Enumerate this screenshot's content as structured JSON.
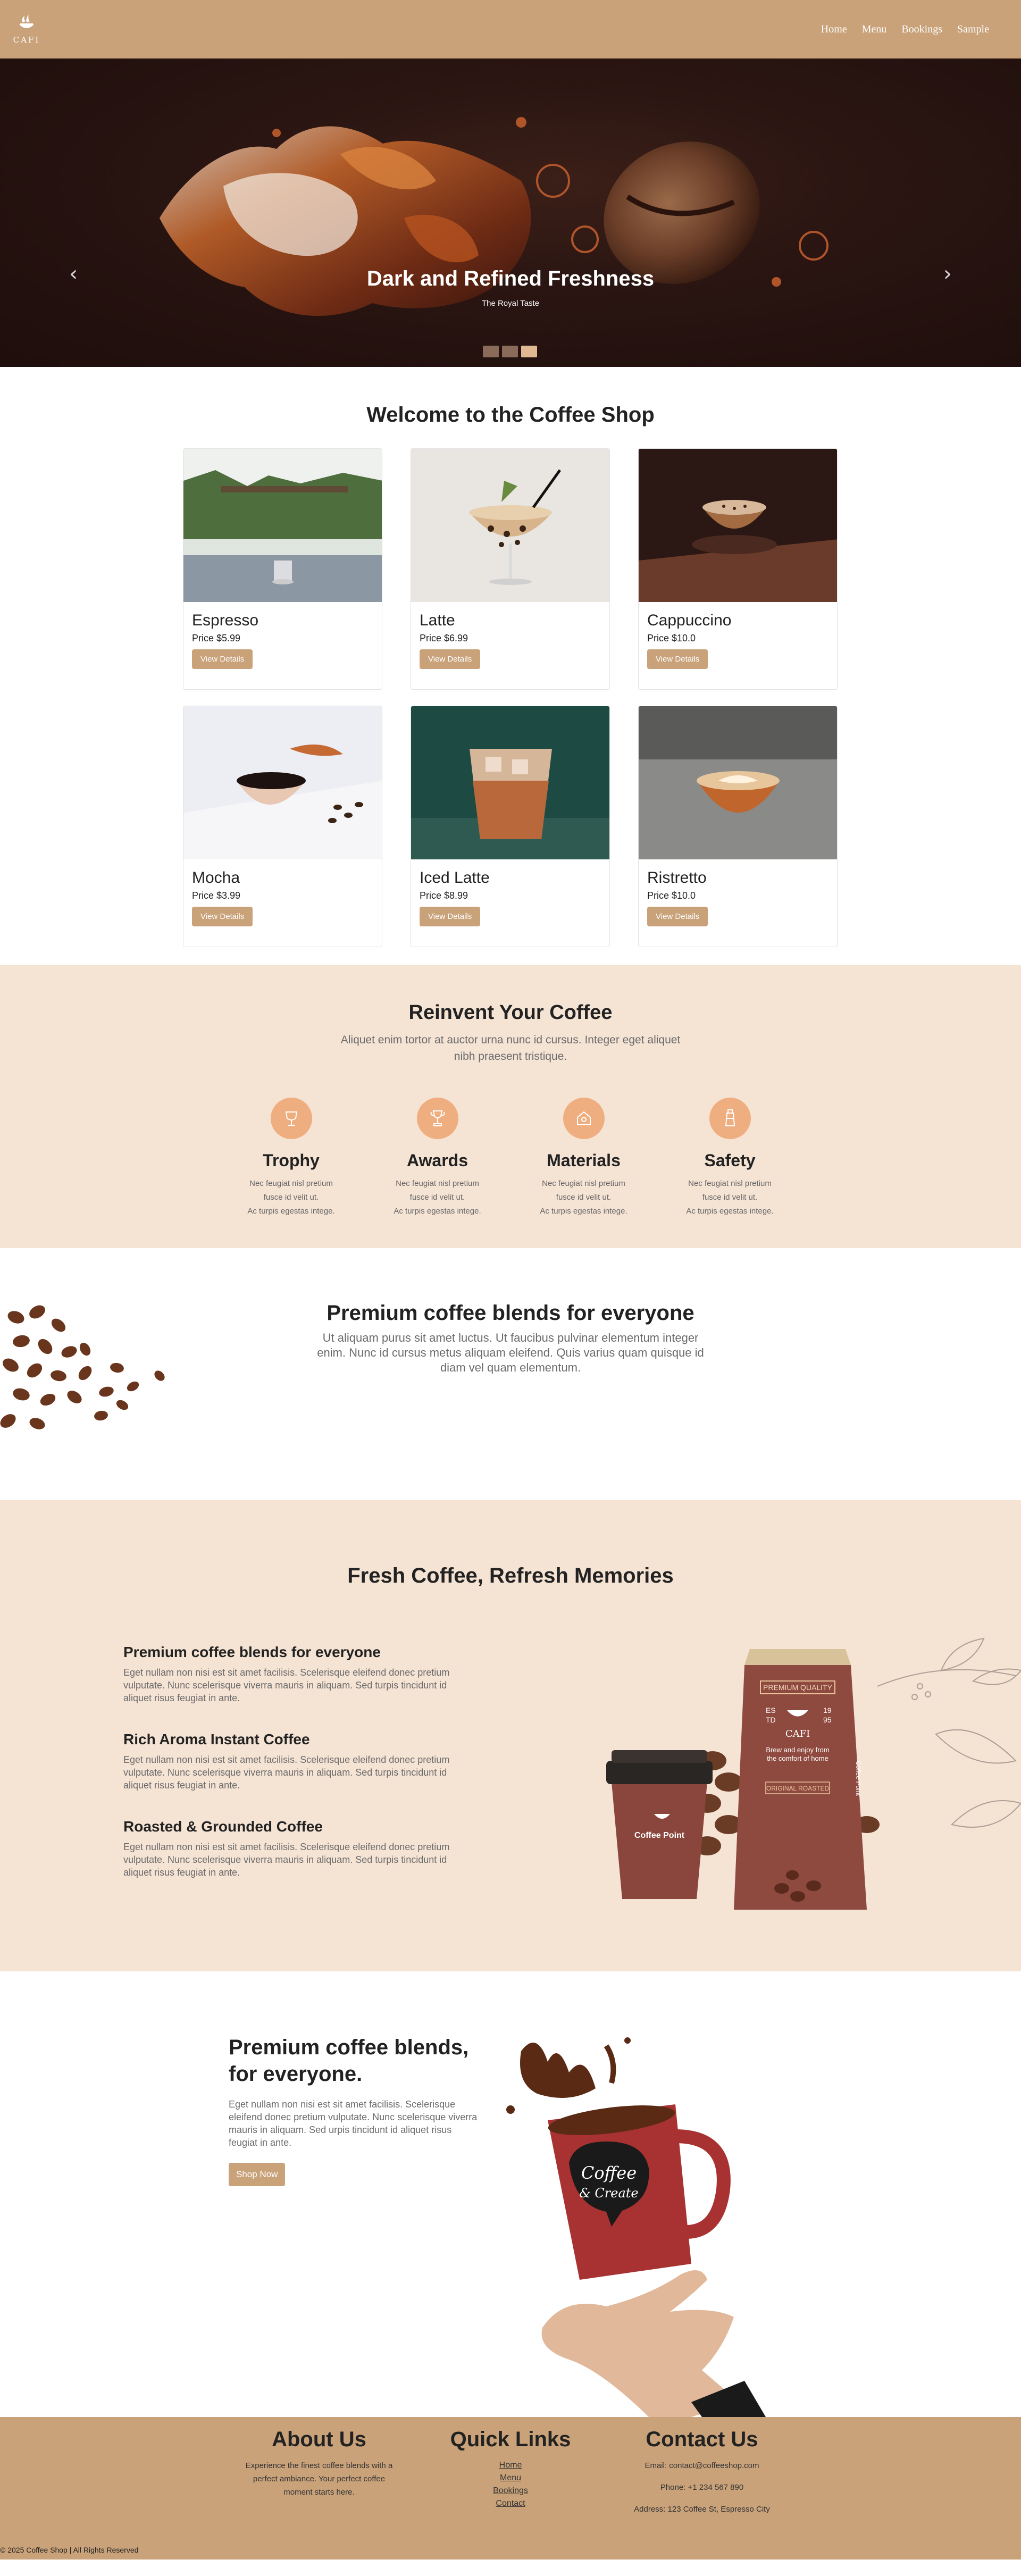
{
  "nav": {
    "logo_text": "CAFI",
    "links": [
      "Home",
      "Menu",
      "Bookings",
      "Sample"
    ]
  },
  "hero": {
    "title": "Dark and Refined Freshness",
    "subtitle": "The Royal Taste",
    "prev_arrow": "‹",
    "next_arrow": "›",
    "active_slide": 3,
    "slide_count": 3
  },
  "welcome": {
    "title": "Welcome to the Coffee Shop",
    "button_label": "View Details",
    "products": [
      {
        "name": "Espresso",
        "price": "Price $5.99"
      },
      {
        "name": "Latte",
        "price": "Price $6.99"
      },
      {
        "name": "Cappuccino",
        "price": "Price $10.0"
      },
      {
        "name": "Mocha",
        "price": "Price $3.99"
      },
      {
        "name": "Iced Latte",
        "price": "Price $8.99"
      },
      {
        "name": "Ristretto",
        "price": "Price $10.0"
      }
    ]
  },
  "reinvent": {
    "title": "Reinvent Your Coffee",
    "subtitle": "Aliquet enim tortor at auctor urna nunc id cursus. Integer eget aliquet nibh praesent tristique.",
    "features": [
      {
        "title": "Trophy",
        "icon": "trophy-icon",
        "line1": "Nec feugiat nisl pretium",
        "line2": "fusce id velit ut.",
        "line3": "Ac turpis egestas intege."
      },
      {
        "title": "Awards",
        "icon": "award-icon",
        "line1": "Nec feugiat nisl pretium",
        "line2": "fusce id velit ut.",
        "line3": "Ac turpis egestas intege."
      },
      {
        "title": "Materials",
        "icon": "materials-icon",
        "line1": "Nec feugiat nisl pretium",
        "line2": "fusce id velit ut.",
        "line3": "Ac turpis egestas intege."
      },
      {
        "title": "Safety",
        "icon": "safety-icon",
        "line1": "Nec feugiat nisl pretium",
        "line2": "fusce id velit ut.",
        "line3": "Ac turpis egestas intege."
      }
    ]
  },
  "premium": {
    "title": "Premium coffee blends for everyone",
    "text": "Ut aliquam purus sit amet luctus. Ut faucibus pulvinar elementum integer enim. Nunc id cursus metus aliquam eleifend. Quis varius quam quisque id diam vel quam elementum."
  },
  "fresh": {
    "title": "Fresh Coffee, Refresh Memories",
    "items": [
      {
        "title": "Premium coffee blends for everyone",
        "text": "Eget nullam non nisi est sit amet facilisis. Scelerisque eleifend donec pretium vulputate. Nunc scelerisque viverra mauris in aliquam. Sed turpis tincidunt id aliquet risus feugiat in ante."
      },
      {
        "title": "Rich Aroma Instant Coffee",
        "text": "Eget nullam non nisi est sit amet facilisis. Scelerisque eleifend donec pretium vulputate. Nunc scelerisque viverra mauris in aliquam. Sed turpis tincidunt id aliquet risus feugiat in ante."
      },
      {
        "title": "Roasted & Grounded Coffee",
        "text": "Eget nullam non nisi est sit amet facilisis. Scelerisque eleifend donec pretium vulputate. Nunc scelerisque viverra mauris in aliquam. Sed turpis tincidunt id aliquet risus feugiat in ante."
      }
    ],
    "bag": {
      "premium_label": "PREMIUM QUALITY",
      "brand": "CAFI",
      "es": "ES",
      "year_left": "TD",
      "nineteen": "19",
      "year_right": "95",
      "tagline": "Brew and enjoy from the comfort of home",
      "roast": "ORIGINAL ROASTED",
      "side": "Coffee Point"
    },
    "cup_label": "Coffee Point"
  },
  "cta": {
    "title_line1": "Premium coffee blends,",
    "title_line2": "for everyone.",
    "text": "Eget nullam non nisi est sit amet facilisis. Scelerisque eleifend donec pretium vulputate. Nunc scelerisque viverra mauris in aliquam. Sed urpis tincidunt id aliquet risus feugiat in ante.",
    "button_label": "Shop Now",
    "mug_line1": "Coffee",
    "mug_line2": "& Create"
  },
  "footer": {
    "about_title": "About Us",
    "about_text": "Experience the finest coffee blends with a perfect ambiance. Your perfect coffee moment starts here.",
    "links_title": "Quick Links",
    "links": [
      "Home",
      "Menu",
      "Bookings",
      "Contact"
    ],
    "contact_title": "Contact Us",
    "email": "Email: contact@coffeeshop.com",
    "phone": "Phone: +1 234 567 890",
    "address": "Address: 123 Coffee St, Espresso City",
    "copyright": "© 2025 Coffee Shop | All Rights Reserved"
  },
  "colors": {
    "brand": "#c9a27a",
    "section_bg": "#f5e3d4",
    "feature_icon_bg": "#efae7f",
    "hero_bg": "#2a1512"
  }
}
